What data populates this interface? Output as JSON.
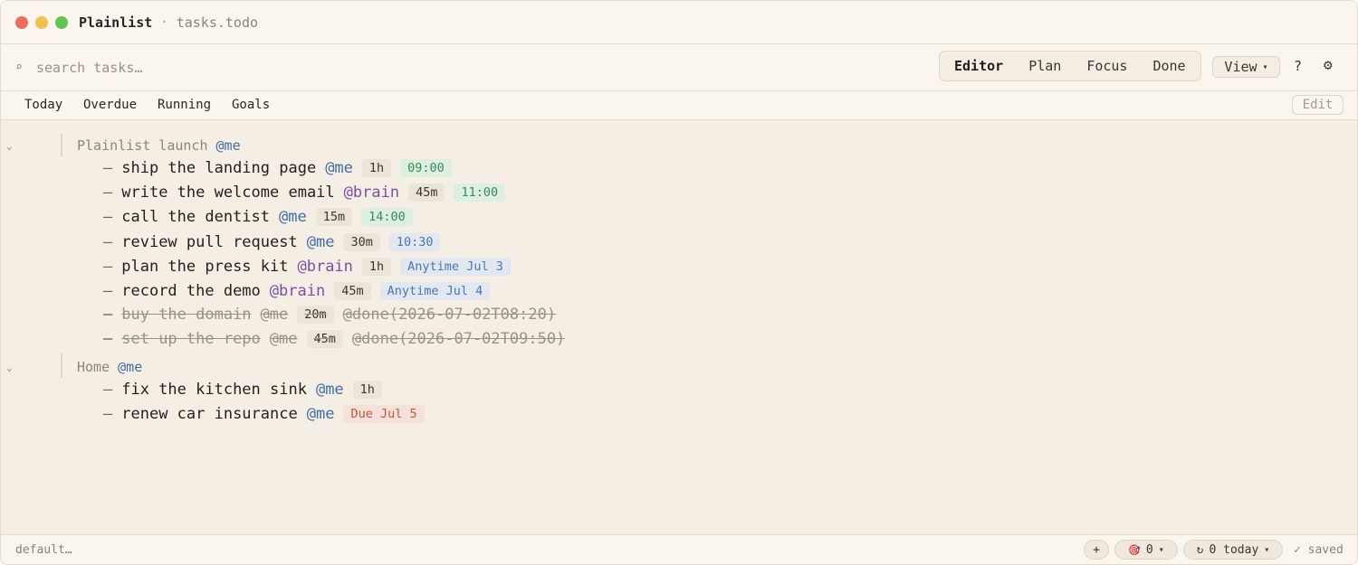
{
  "titlebar": {
    "app_name": "Plainlist",
    "separator": "·",
    "file_name": "tasks.todo"
  },
  "toolbar": {
    "search_placeholder": "search tasks…",
    "search_icon": "⌕",
    "modes": [
      "Editor",
      "Plan",
      "Focus",
      "Done"
    ],
    "active_mode": "Editor",
    "view_label": "View",
    "view_caret": "▾",
    "help_label": "?",
    "settings_icon": "⚙"
  },
  "filters": {
    "items": [
      "Today",
      "Overdue",
      "Running",
      "Goals"
    ],
    "edit_label": "Edit"
  },
  "groups": [
    {
      "fold": "⌄",
      "title": "Plainlist launch",
      "owner": "@me",
      "tasks": [
        {
          "text": "ship the landing page",
          "who": "@me",
          "dur": "1h",
          "time": "09:00"
        },
        {
          "text": "write the welcome email",
          "who": "@brain",
          "dur": "45m",
          "time": "11:00"
        },
        {
          "text": "call the dentist",
          "who": "@me",
          "dur": "15m",
          "time": "14:00"
        },
        {
          "text": "review pull request",
          "who": "@me",
          "dur": "30m",
          "time": "10:30"
        },
        {
          "text": "plan the press kit",
          "who": "@brain",
          "dur": "1h",
          "anytime": "Anytime Jul 3"
        },
        {
          "text": "record the demo",
          "who": "@brain",
          "dur": "45m",
          "anytime": "Anytime Jul 4"
        },
        {
          "text": "buy the domain",
          "who": "@me",
          "dur": "20m",
          "done": "@done(2026-07-02T08:20)"
        },
        {
          "text": "set up the repo",
          "who": "@me",
          "dur": "45m",
          "done": "@done(2026-07-02T09:50)"
        }
      ]
    },
    {
      "fold": "⌄",
      "title": "Home",
      "owner": "@me",
      "tasks": [
        {
          "text": "fix the kitchen sink",
          "who": "@me",
          "dur": "1h"
        },
        {
          "text": "renew car insurance",
          "who": "@me",
          "due": "Due Jul 5"
        }
      ]
    }
  ],
  "dash": "–",
  "statusbar": {
    "left": "default…",
    "add_label": "+",
    "goal_icon": "🎯",
    "goal_count": "0",
    "goal_caret": "▾",
    "repeat_icon": "↻",
    "repeat_label": "0 today",
    "repeat_caret": "▾",
    "saved_label": "✓ saved"
  }
}
